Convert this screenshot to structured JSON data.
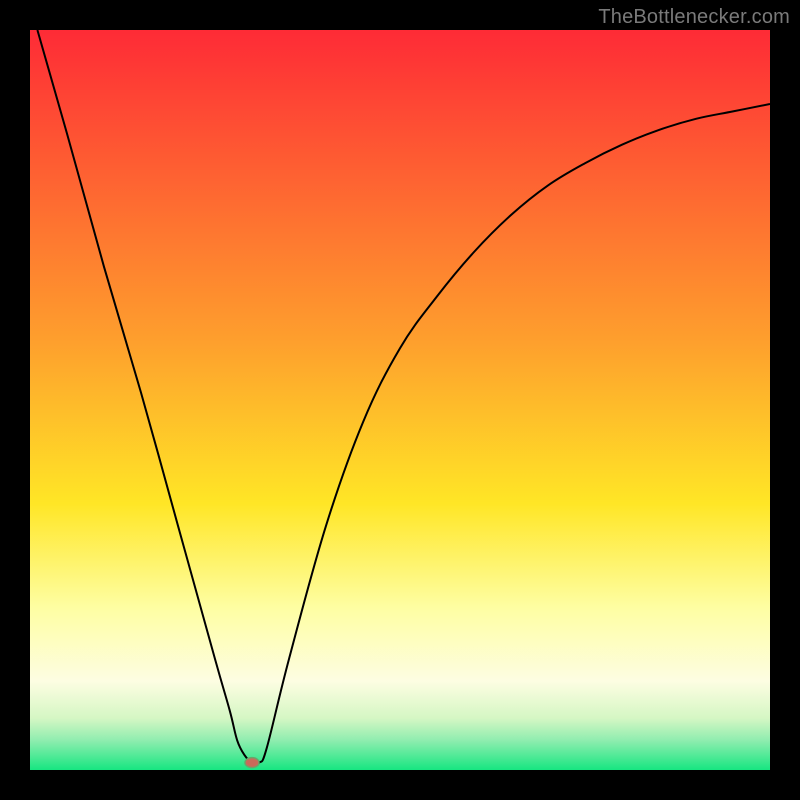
{
  "watermark": "TheBottlenecker.com",
  "chart_data": {
    "type": "line",
    "title": "",
    "xlabel": "",
    "ylabel": "",
    "xlim": [
      0,
      100
    ],
    "ylim": [
      0,
      100
    ],
    "x": [
      1,
      5,
      10,
      15,
      20,
      25,
      27,
      28,
      29,
      30,
      31,
      32,
      35,
      40,
      45,
      50,
      55,
      60,
      65,
      70,
      75,
      80,
      85,
      90,
      95,
      100
    ],
    "values": [
      100,
      86,
      68,
      51,
      33,
      15,
      8,
      4,
      2,
      1,
      1,
      3,
      15,
      33,
      47,
      57,
      64,
      70,
      75,
      79,
      82,
      84.5,
      86.5,
      88,
      89,
      90
    ],
    "minimum_marker": {
      "x": 30,
      "y": 1
    },
    "background": {
      "type": "vertical-gradient",
      "stops": [
        {
          "pos": 0,
          "color": "#fe2b36"
        },
        {
          "pos": 42,
          "color": "#fe9f2d"
        },
        {
          "pos": 64,
          "color": "#ffe626"
        },
        {
          "pos": 78,
          "color": "#fefea2"
        },
        {
          "pos": 88,
          "color": "#fdfde2"
        },
        {
          "pos": 93,
          "color": "#d5f7c4"
        },
        {
          "pos": 96,
          "color": "#8fedaf"
        },
        {
          "pos": 100,
          "color": "#17e681"
        }
      ]
    },
    "line_color": "#000000",
    "marker_fill": "#c96a5a",
    "marker_stroke": "#6aa56a"
  }
}
